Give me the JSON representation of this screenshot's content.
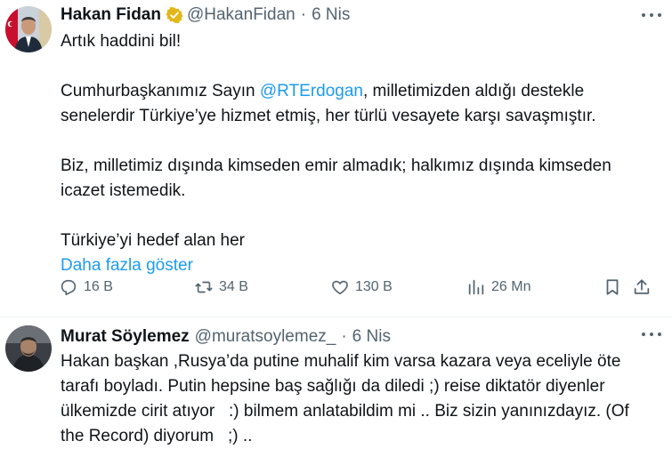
{
  "tweet1": {
    "name": "Hakan Fidan",
    "handle": "@HakanFidan",
    "sep": "·",
    "date": "6 Nis",
    "line1": "Artık haddini bil!",
    "p2_pre": "Cumhurbaşkanımız Sayın ",
    "p2_mention": "@RTErdogan",
    "p2_mid": ", milletimizden aldığı destekle",
    "p2_line2": "senelerdir Türkiye’ye hizmet etmiş, her türlü vesayete karşı savaşmıştır.",
    "p3_line1": "Biz, milletimiz dışında kimseden emir almadık; halkımız dışında kimseden",
    "p3_line2": "icazet istemedik.",
    "p4_line1": "Türkiye’yi hedef alan her",
    "show_more": "Daha fazla göster",
    "replies": "16 B",
    "reposts": "34 B",
    "likes": "130 B",
    "views": "26 Mn"
  },
  "tweet2": {
    "name": "Murat Söylemez",
    "handle": "@muratsoylemez_",
    "sep": "·",
    "date": "6 Nis",
    "line1": "Hakan başkan ,Rusya’da putine muhalif kim varsa kazara veya eceliyle öte",
    "line2": "tarafı boyladı. Putin hepsine baş sağlığı da diledi ;) reise diktatör diyenler",
    "line3": "ülkemizde cirit atıyor   :) bilmem anlatabildim mi .. Biz sizin yanınızdayız. (Of",
    "line4": "the Record) diyorum   ;) .."
  },
  "colors": {
    "accent": "#1d9bf0",
    "text": "#0f1419",
    "muted": "#536471",
    "verified_gold": "#e2b719"
  },
  "icons": {
    "verified": "verified-gold-badge-icon",
    "more": "more-dots-icon",
    "reply": "reply-icon",
    "repost": "repost-icon",
    "like": "heart-icon",
    "views": "views-chart-icon",
    "bookmark": "bookmark-icon",
    "share": "share-icon"
  }
}
